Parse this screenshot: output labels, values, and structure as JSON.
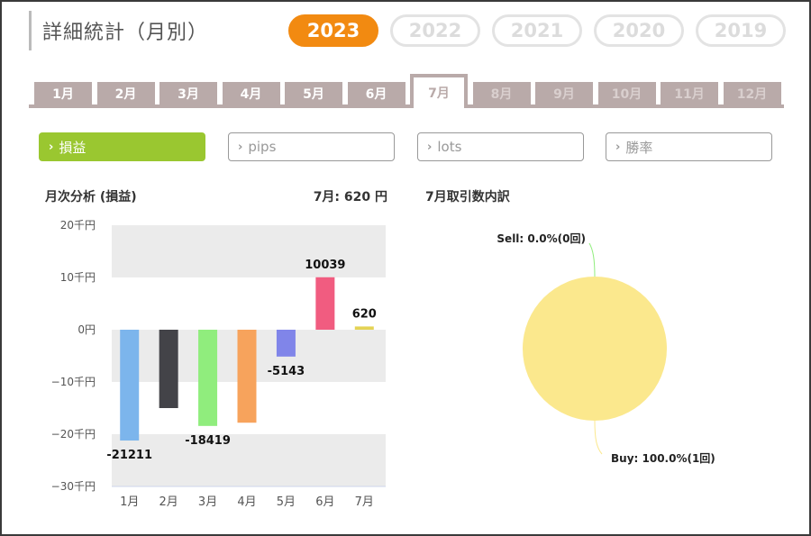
{
  "title": "詳細統計（月別）",
  "years": [
    {
      "label": "2023",
      "active": true
    },
    {
      "label": "2022",
      "active": false
    },
    {
      "label": "2021",
      "active": false
    },
    {
      "label": "2020",
      "active": false
    },
    {
      "label": "2019",
      "active": false
    }
  ],
  "months": [
    {
      "label": "1月",
      "state": "past"
    },
    {
      "label": "2月",
      "state": "past"
    },
    {
      "label": "3月",
      "state": "past"
    },
    {
      "label": "4月",
      "state": "past"
    },
    {
      "label": "5月",
      "state": "past"
    },
    {
      "label": "6月",
      "state": "past"
    },
    {
      "label": "7月",
      "state": "active"
    },
    {
      "label": "8月",
      "state": "future"
    },
    {
      "label": "9月",
      "state": "future"
    },
    {
      "label": "10月",
      "state": "future"
    },
    {
      "label": "11月",
      "state": "future"
    },
    {
      "label": "12月",
      "state": "future"
    }
  ],
  "metrics": [
    {
      "label": "損益",
      "active": true
    },
    {
      "label": "pips",
      "active": false
    },
    {
      "label": "lots",
      "active": false
    },
    {
      "label": "勝率",
      "active": false
    }
  ],
  "chevron": "›",
  "monthly_heading": "月次分析 (損益)",
  "current_summary": "7月:  620 円",
  "trades_heading": "7月取引数内訳",
  "chart_data": [
    {
      "type": "bar",
      "categories": [
        "1月",
        "2月",
        "3月",
        "4月",
        "5月",
        "6月",
        "7月"
      ],
      "values": [
        -21211,
        -15000,
        -18419,
        -17800,
        -5143,
        10039,
        620
      ],
      "data_labels": [
        "-21211",
        "",
        "-18419",
        "",
        "-5143",
        "10039",
        "620"
      ],
      "colors": [
        "#7cb5ec",
        "#434348",
        "#90ed7d",
        "#f7a35c",
        "#8085e9",
        "#f15c80",
        "#e4d354"
      ],
      "ylim": [
        -30000,
        20000
      ],
      "yticks": [
        {
          "value": 20000,
          "label": "20千円"
        },
        {
          "value": 10000,
          "label": "10千円"
        },
        {
          "value": 0,
          "label": "0円"
        },
        {
          "value": -10000,
          "label": "−10千円"
        },
        {
          "value": -20000,
          "label": "−20千円"
        },
        {
          "value": -30000,
          "label": "−30千円"
        }
      ],
      "band_color": "#ebebeb"
    },
    {
      "type": "pie",
      "slices": [
        {
          "name": "Sell",
          "value": 0,
          "label": "Sell: 0.0%(0回)",
          "color": "#90ed7d"
        },
        {
          "name": "Buy",
          "value": 100,
          "label": "Buy: 100.0%(1回)",
          "color": "#fbe88d"
        }
      ]
    }
  ]
}
